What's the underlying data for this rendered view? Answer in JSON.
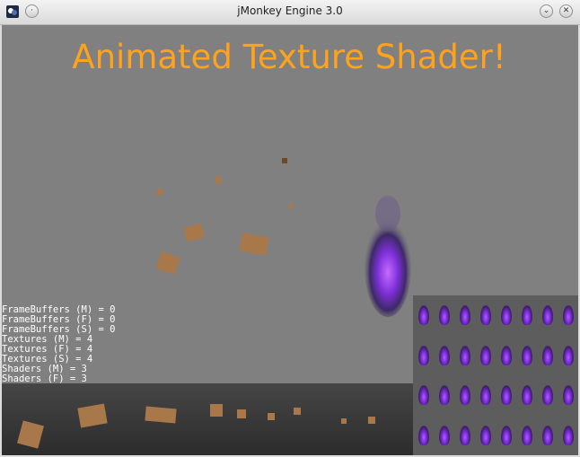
{
  "window": {
    "title": "jMonkey Engine 3.0",
    "accent_title_color": "#ffa31a",
    "viewport_color": "#808080"
  },
  "titlebar_buttons": [
    "menu-icon",
    "minimize-icon",
    "maximize-icon",
    "close-icon"
  ],
  "scene": {
    "headline": "Animated Texture Shader!"
  },
  "stats": [
    {
      "label": "FrameBuffers (M) = 0"
    },
    {
      "label": "FrameBuffers (F) = 0"
    },
    {
      "label": "FrameBuffers (S) = 0"
    },
    {
      "label": "Textures (M) = 4"
    },
    {
      "label": "Textures (F) = 4"
    },
    {
      "label": "Textures (S) = 4"
    },
    {
      "label": "Shaders (M) = 3"
    },
    {
      "label": "Shaders (F) = 3"
    }
  ],
  "sprite_atlas": {
    "rows": 4,
    "cols": 8,
    "color": "#9b3cff"
  }
}
